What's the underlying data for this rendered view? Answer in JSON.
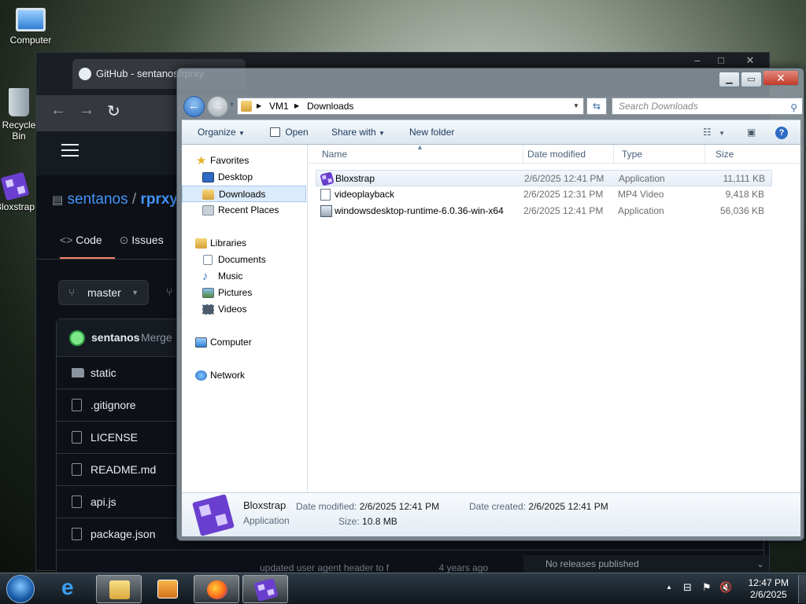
{
  "desktop": {
    "icons": [
      {
        "label": "Computer"
      },
      {
        "label": "Recycle Bin"
      },
      {
        "label": "Bloxstrap"
      }
    ]
  },
  "github_window": {
    "tab_title": "GitHub - sentanos/rprxy",
    "owner": "sentanos",
    "separator": "/",
    "repo": "rprxy",
    "tabs": [
      {
        "label": "Code"
      },
      {
        "label": "Issues"
      }
    ],
    "branch": "master",
    "commit_author": "sentanos",
    "commit_message": "Merge",
    "files": [
      {
        "name": "static",
        "kind": "folder"
      },
      {
        "name": ".gitignore",
        "kind": "file"
      },
      {
        "name": "LICENSE",
        "kind": "file"
      },
      {
        "name": "README.md",
        "kind": "file"
      },
      {
        "name": "api.js",
        "kind": "file"
      },
      {
        "name": "package.json",
        "kind": "file"
      }
    ],
    "behind_commit_text": "updated user agent header to f",
    "behind_time_text": "4 years ago",
    "releases_text": "No releases published"
  },
  "explorer": {
    "address": {
      "segments": [
        "VM1",
        "Downloads"
      ]
    },
    "search_placeholder": "Search Downloads",
    "toolbar": {
      "organize": "Organize",
      "open": "Open",
      "share_with": "Share with",
      "new_folder": "New folder"
    },
    "nav": {
      "favorites": {
        "label": "Favorites",
        "items": [
          "Desktop",
          "Downloads",
          "Recent Places"
        ]
      },
      "libraries": {
        "label": "Libraries",
        "items": [
          "Documents",
          "Music",
          "Pictures",
          "Videos"
        ]
      },
      "computer": "Computer",
      "network": "Network"
    },
    "columns": {
      "name": "Name",
      "date": "Date modified",
      "type": "Type",
      "size": "Size"
    },
    "files": [
      {
        "name": "Bloxstrap",
        "date": "2/6/2025 12:41 PM",
        "type": "Application",
        "size": "11,111 KB",
        "selected": true
      },
      {
        "name": "videoplayback",
        "date": "2/6/2025 12:31 PM",
        "type": "MP4 Video",
        "size": "9,418 KB",
        "selected": false
      },
      {
        "name": "windowsdesktop-runtime-6.0.36-win-x64",
        "date": "2/6/2025 12:41 PM",
        "type": "Application",
        "size": "56,036 KB",
        "selected": false
      }
    ],
    "details": {
      "name": "Bloxstrap",
      "kind": "Application",
      "date_modified_label": "Date modified:",
      "date_modified": "2/6/2025 12:41 PM",
      "date_created_label": "Date created:",
      "date_created": "2/6/2025 12:41 PM",
      "size_label": "Size:",
      "size": "10.8 MB"
    }
  },
  "taskbar": {
    "clock_time": "12:47 PM",
    "clock_date": "2/6/2025"
  }
}
